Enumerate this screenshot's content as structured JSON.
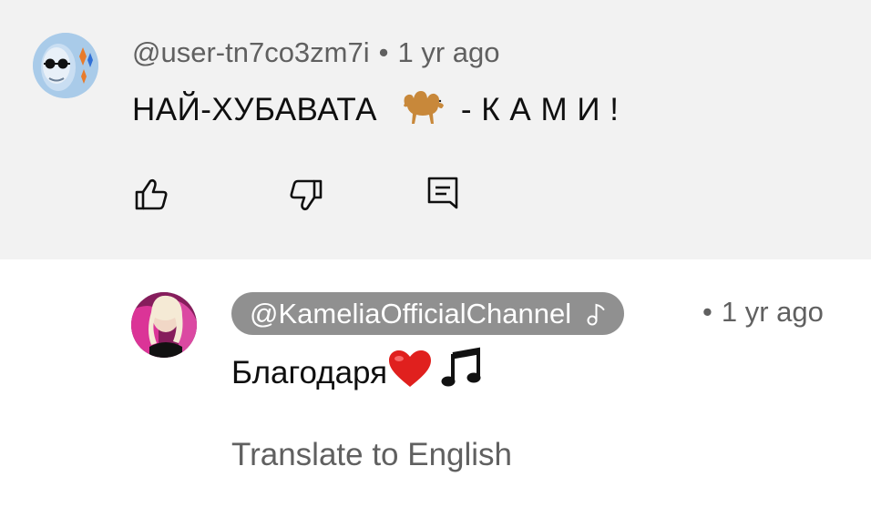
{
  "comment": {
    "username": "@user-tn7co3zm7i",
    "separator": "•",
    "time": "1 yr ago",
    "text_before_emoji": "НАЙ-ХУБАВАТА",
    "emoji": "camel",
    "text_after_emoji": "- К А М И !",
    "actions": {
      "like_icon": "thumbs-up-icon",
      "dislike_icon": "thumbs-down-icon",
      "reply_icon": "reply-icon"
    }
  },
  "reply": {
    "username": "@KameliaOfficialChannel",
    "badge_icon": "music-note-icon",
    "separator": "•",
    "time": "1 yr ago",
    "text": "Благодаря",
    "emojis": [
      "red-heart",
      "musical-notes"
    ],
    "translate_label": "Translate to English"
  },
  "colors": {
    "comment_background": "#f2f2f2",
    "owner_pill": "#909090",
    "secondary_text": "#606060",
    "primary_text": "#0f0f0f",
    "heart_red": "#e0201e"
  }
}
